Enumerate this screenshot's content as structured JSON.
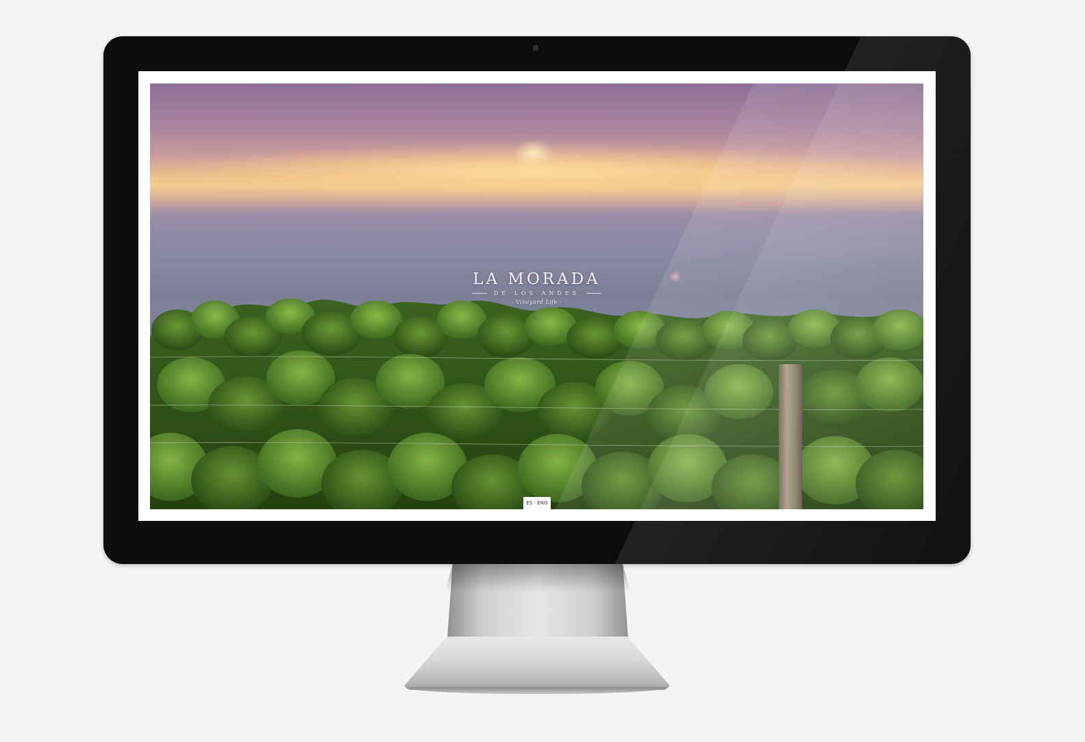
{
  "site": {
    "logo": {
      "title": "LA MORADA",
      "subtitle": "DE LOS ANDES",
      "tagline": "- Vineyard Life -"
    },
    "language": {
      "options": [
        "ES",
        "ENG"
      ],
      "separator": "-"
    }
  },
  "colors": {
    "background": "#f4f4f4",
    "bezel": "#0c0c0c",
    "screen_frame": "#ffffff",
    "logo_text": "#f3eef2"
  },
  "icons": {
    "camera": "camera-dot-icon"
  }
}
